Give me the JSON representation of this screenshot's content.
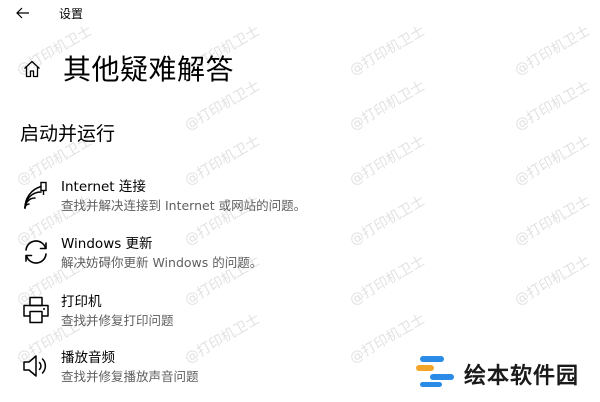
{
  "window": {
    "title": "设置"
  },
  "page": {
    "title": "其他疑难解答"
  },
  "section": {
    "title": "启动并运行"
  },
  "items": [
    {
      "label": "Internet 连接",
      "description": "查找并解决连接到 Internet 或网站的问题。",
      "icon": "wifi-antenna-icon"
    },
    {
      "label": "Windows 更新",
      "description": "解决妨碍你更新 Windows 的问题。",
      "icon": "refresh-icon"
    },
    {
      "label": "打印机",
      "description": "查找并修复打印问题",
      "icon": "printer-icon"
    },
    {
      "label": "播放音频",
      "description": "查找并修复播放声音问题",
      "icon": "speaker-icon"
    }
  ],
  "watermark": {
    "text": "@打印机卫士"
  },
  "brand": {
    "name": "绘本软件园",
    "colors": [
      "#2b8be6",
      "#f4a62a"
    ]
  }
}
